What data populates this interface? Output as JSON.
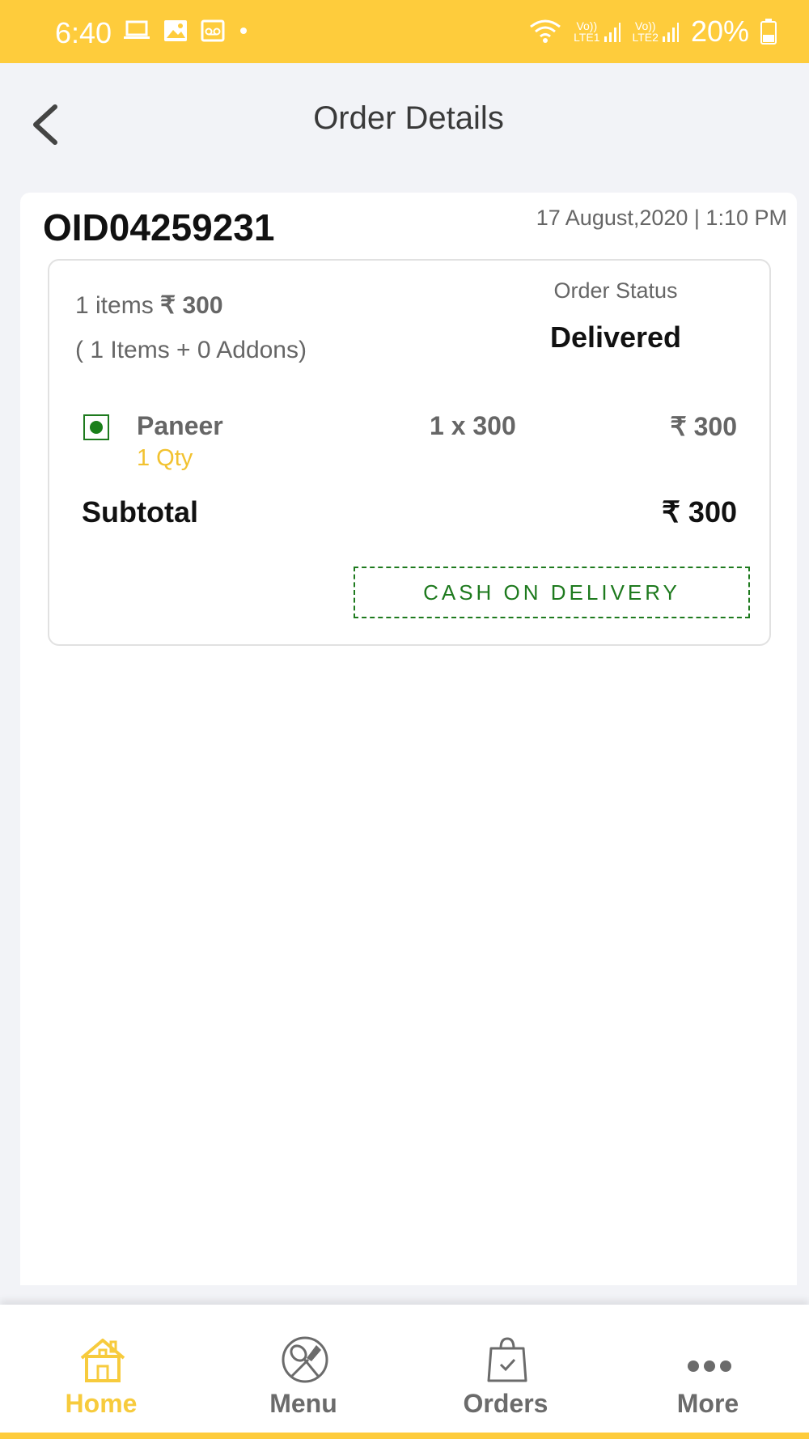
{
  "status_bar": {
    "time": "6:40",
    "battery": "20%",
    "sim1": "LTE1",
    "sim2": "LTE2",
    "volte": "Vo))"
  },
  "header": {
    "title": "Order Details"
  },
  "order": {
    "id": "OID04259231",
    "datetime": "17 August,2020 | 1:10 PM",
    "items_count_text": "1 items",
    "items_total": "₹ 300",
    "addons_text": "( 1 Items + 0 Addons)",
    "status_label": "Order Status",
    "status_value": "Delivered",
    "line_items": [
      {
        "name": "Paneer",
        "qty": "1 Qty",
        "calc": "1 x 300",
        "price": "₹ 300",
        "veg": true
      }
    ],
    "subtotal_label": "Subtotal",
    "subtotal_value": "₹ 300",
    "payment_method": "CASH ON DELIVERY"
  },
  "bottom_nav": {
    "items": [
      {
        "label": "Home",
        "icon": "home-icon",
        "active": true
      },
      {
        "label": "Menu",
        "icon": "menu-icon",
        "active": false
      },
      {
        "label": "Orders",
        "icon": "orders-icon",
        "active": false
      },
      {
        "label": "More",
        "icon": "more-icon",
        "active": false
      }
    ]
  },
  "colors": {
    "accent": "#fecc3c",
    "veg_green": "#1e7a1e",
    "active_nav": "#f7cb3d"
  }
}
